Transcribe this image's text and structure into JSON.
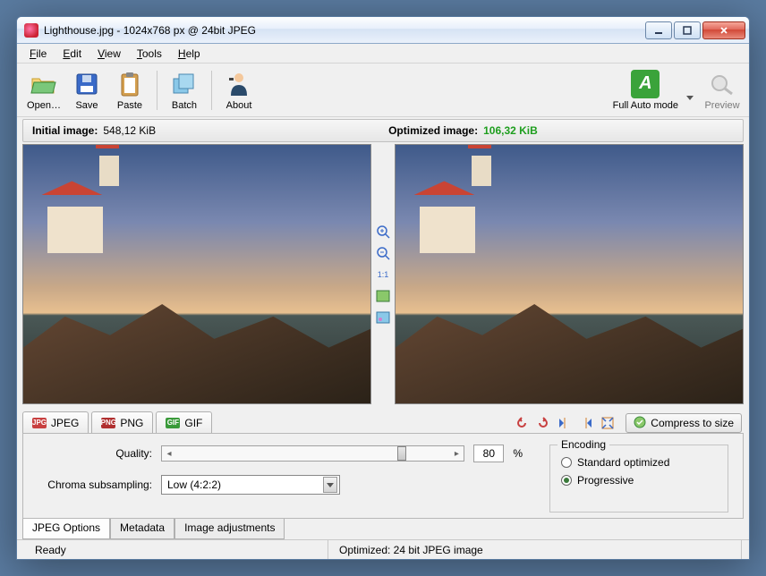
{
  "window": {
    "title": "Lighthouse.jpg - 1024x768 px @ 24bit JPEG"
  },
  "menu": {
    "file": "File",
    "edit": "Edit",
    "view": "View",
    "tools": "Tools",
    "help": "Help"
  },
  "toolbar": {
    "open": "Open…",
    "save": "Save",
    "paste": "Paste",
    "batch": "Batch",
    "about": "About",
    "fullauto": "Full Auto mode",
    "preview": "Preview"
  },
  "sizes": {
    "initial_label": "Initial image:",
    "initial_value": "548,12 KiB",
    "optimized_label": "Optimized image:",
    "optimized_value": "106,32 KiB"
  },
  "midtools": {
    "onetoone": "1:1"
  },
  "format_tabs": {
    "jpeg": "JPEG",
    "png": "PNG",
    "gif": "GIF"
  },
  "actions": {
    "compress": "Compress to size"
  },
  "options": {
    "quality_label": "Quality:",
    "quality_value": "80",
    "quality_unit": "%",
    "chroma_label": "Chroma subsampling:",
    "chroma_value": "Low (4:2:2)",
    "encoding_title": "Encoding",
    "radio_standard": "Standard optimized",
    "radio_progressive": "Progressive"
  },
  "bottom_tabs": {
    "jpeg_options": "JPEG Options",
    "metadata": "Metadata",
    "image_adjustments": "Image adjustments"
  },
  "status": {
    "ready": "Ready",
    "optimized": "Optimized: 24 bit JPEG image"
  }
}
